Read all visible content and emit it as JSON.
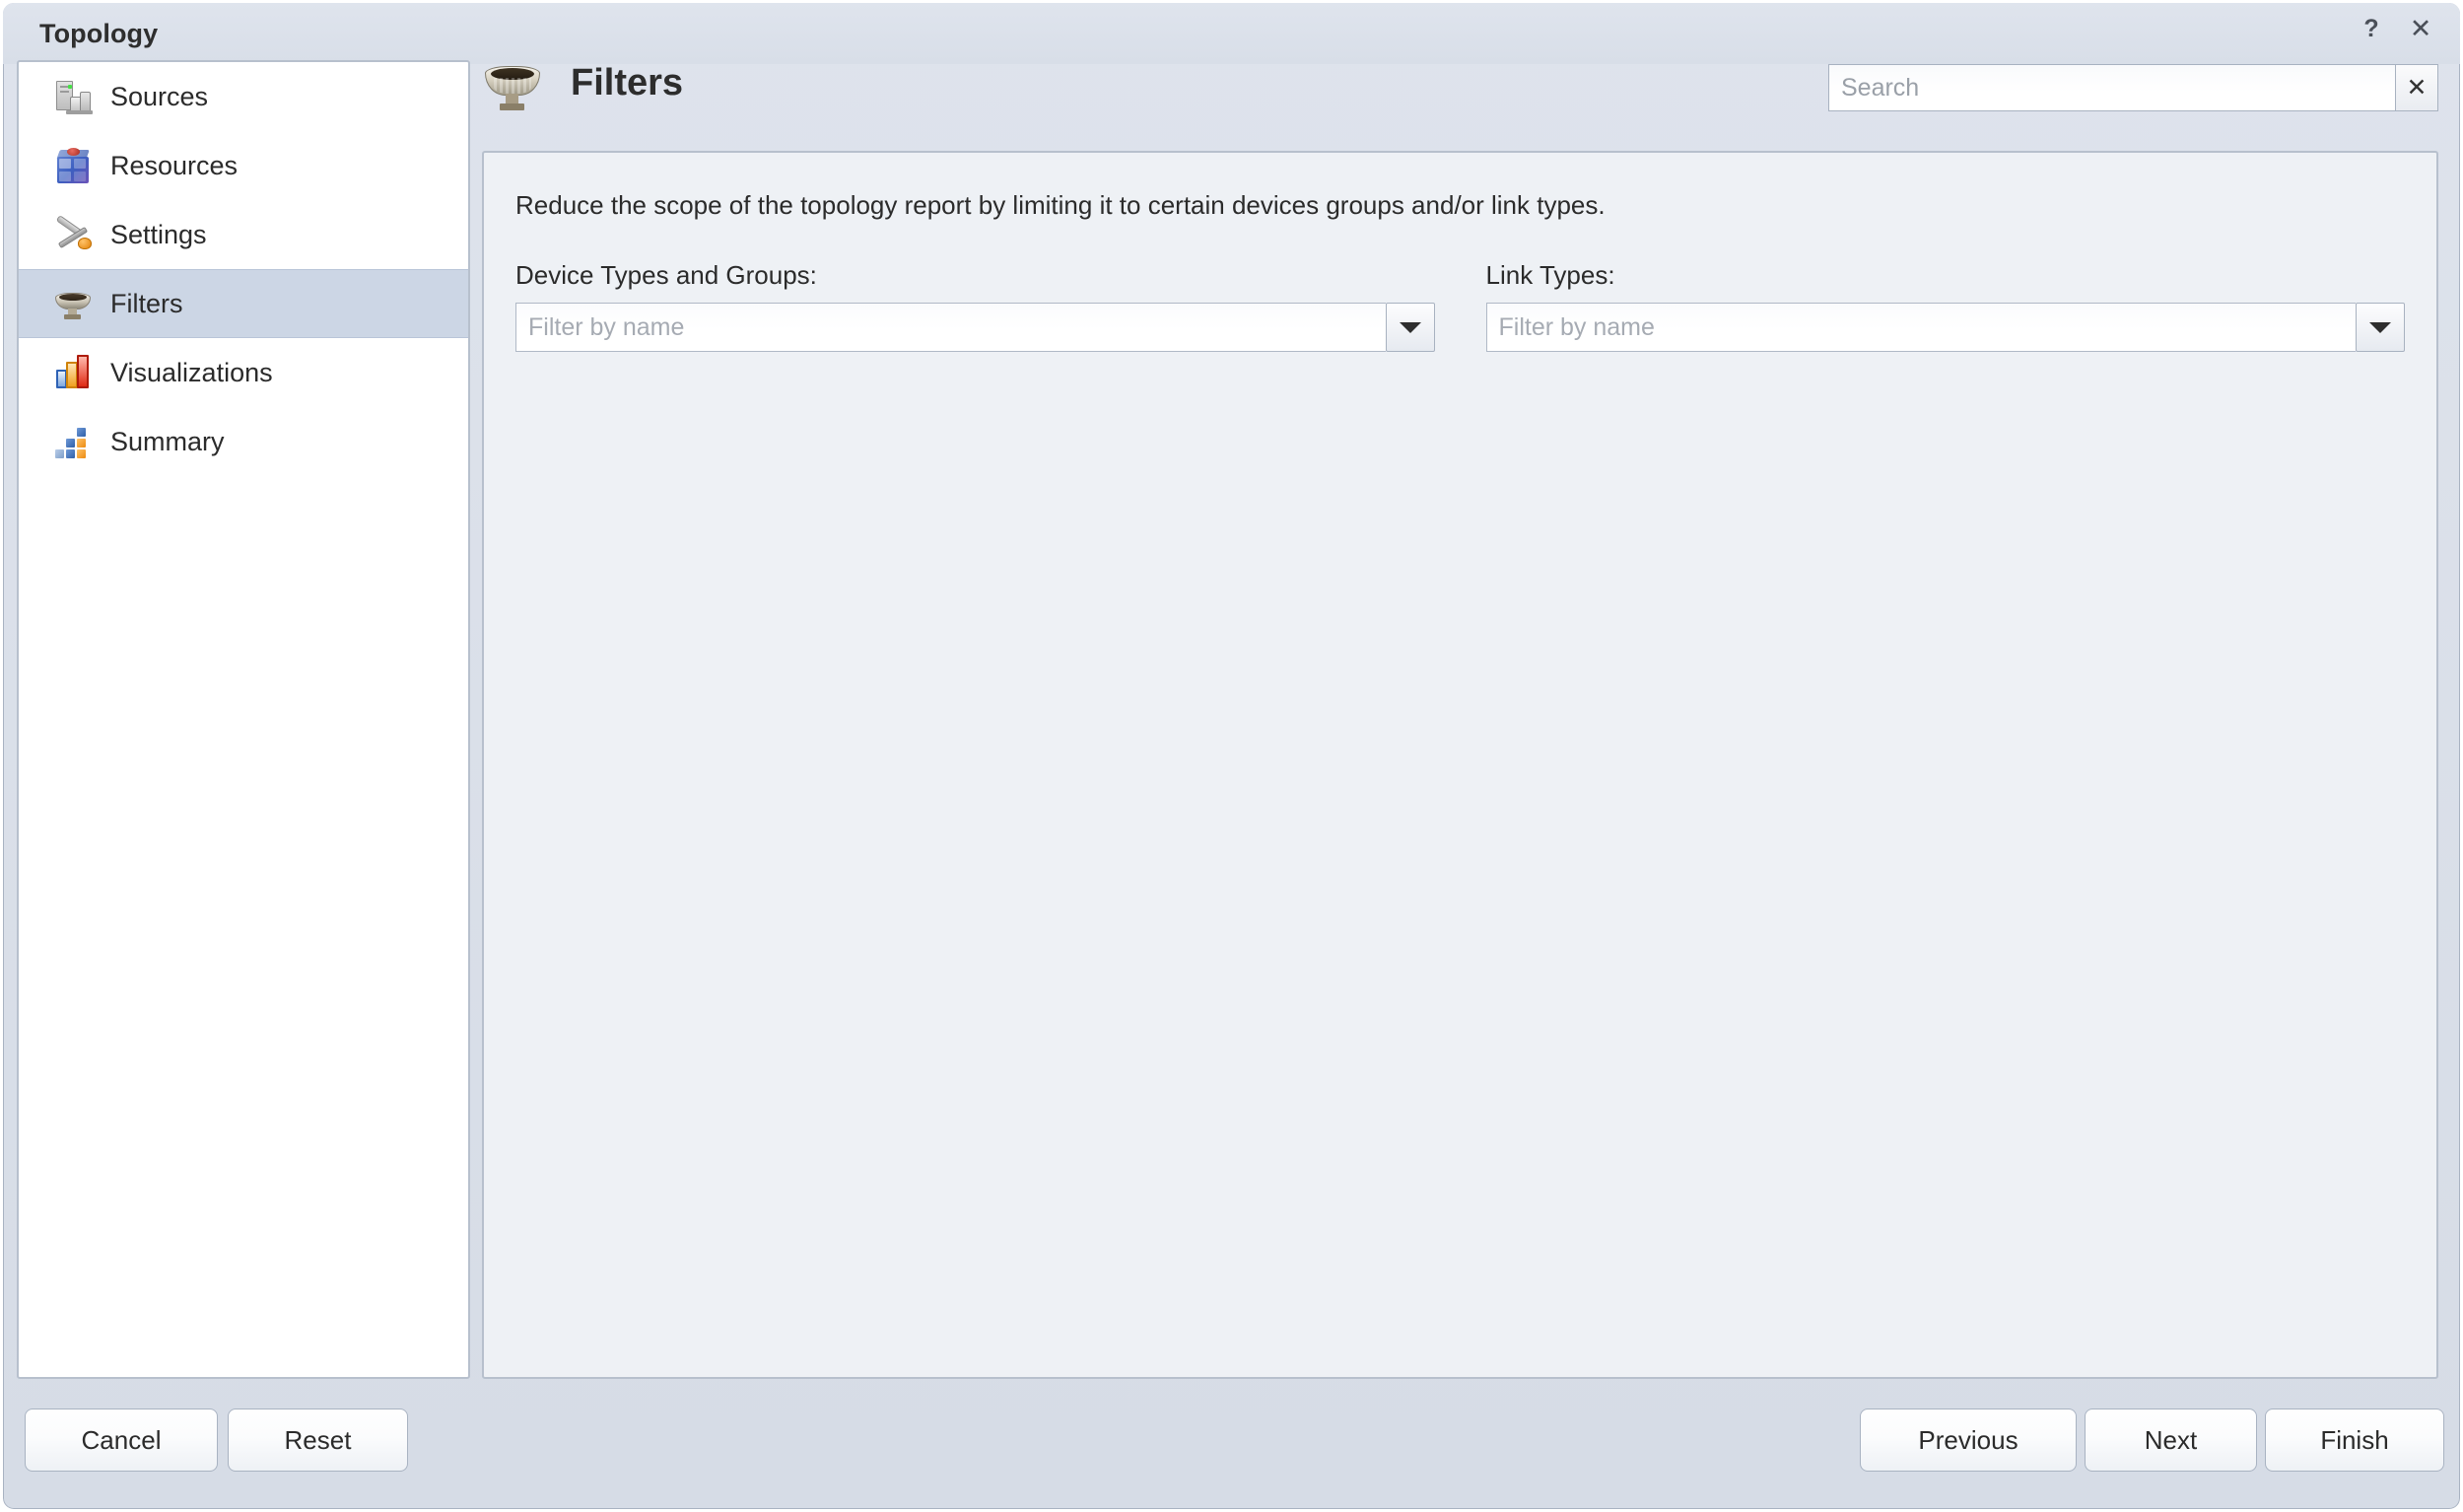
{
  "window": {
    "title": "Topology",
    "help_label": "?",
    "close_label": "✕"
  },
  "sidebar": {
    "items": [
      {
        "label": "Sources",
        "icon": "server-icon",
        "selected": false
      },
      {
        "label": "Resources",
        "icon": "cube-icon",
        "selected": false
      },
      {
        "label": "Settings",
        "icon": "tools-icon",
        "selected": false
      },
      {
        "label": "Filters",
        "icon": "funnel-icon",
        "selected": true
      },
      {
        "label": "Visualizations",
        "icon": "bar-chart-icon",
        "selected": false
      },
      {
        "label": "Summary",
        "icon": "blocks-icon",
        "selected": false
      }
    ]
  },
  "header": {
    "title": "Filters",
    "icon": "funnel-icon",
    "search": {
      "value": "",
      "placeholder": "Search",
      "clear_label": "✕"
    }
  },
  "main": {
    "description": "Reduce the scope of the topology report by limiting it to certain devices groups and/or link types.",
    "device_field": {
      "label": "Device Types and Groups:",
      "value": "",
      "placeholder": "Filter by name"
    },
    "link_field": {
      "label": "Link Types:",
      "value": "",
      "placeholder": "Filter by name"
    }
  },
  "footer": {
    "cancel_label": "Cancel",
    "reset_label": "Reset",
    "previous_label": "Previous",
    "next_label": "Next",
    "finish_label": "Finish"
  },
  "colors": {
    "window_bg": "#dee3ec",
    "titlebar": "#dfe4ed",
    "panel_bg": "#eef1f5",
    "sidebar_bg": "#ffffff",
    "selection": "#ccd6e5",
    "border": "#b7c0cd",
    "text": "#2b2b2b",
    "placeholder": "#a6abb3"
  }
}
